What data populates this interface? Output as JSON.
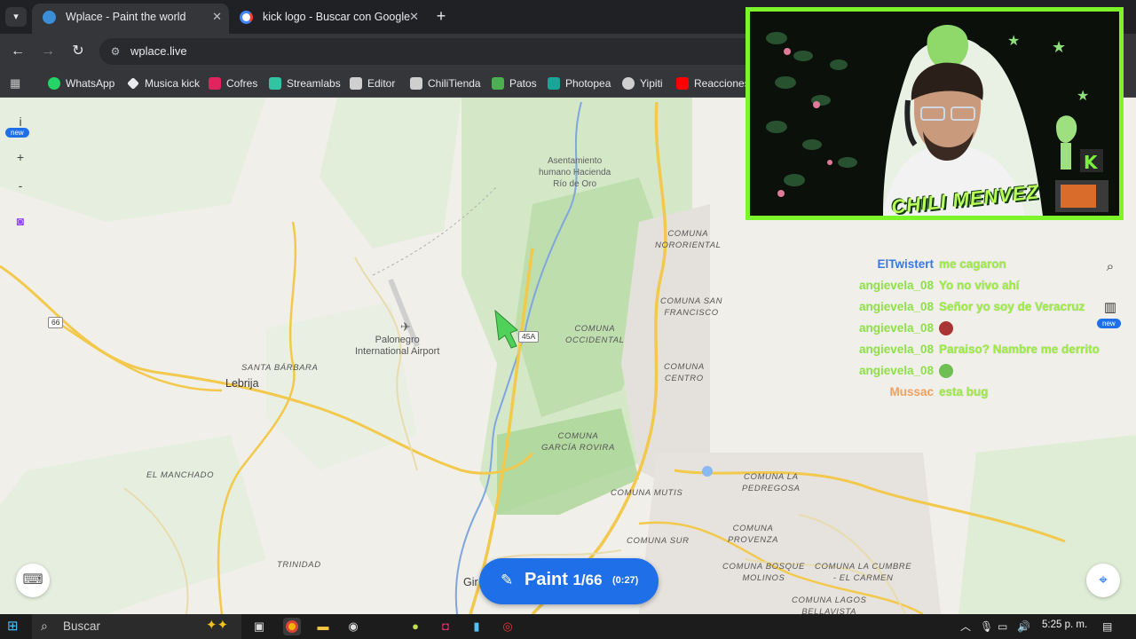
{
  "tabs": [
    {
      "title": "Wplace - Paint the world",
      "active": true,
      "favicon_color": "#3b8fd9"
    },
    {
      "title": "kick logo - Buscar con Google",
      "active": false,
      "favicon_color": "#e8eaed"
    }
  ],
  "toolbar": {
    "url": "wplace.live",
    "back_icon": "arrow-left-icon",
    "forward_icon": "arrow-right-icon",
    "reload_icon": "reload-icon"
  },
  "bookmarks": [
    {
      "label": "WhatsApp",
      "color": "#25d366"
    },
    {
      "label": "Musica kick",
      "color": "#e8eaed"
    },
    {
      "label": "Cofres",
      "color": "#e0245e"
    },
    {
      "label": "Streamlabs",
      "color": "#31c3a2"
    },
    {
      "label": "Editor",
      "color": "#cfcfcf"
    },
    {
      "label": "ChiliTienda",
      "color": "#cfcfcf"
    },
    {
      "label": "Patos",
      "color": "#4caf50"
    },
    {
      "label": "Photopea",
      "color": "#18a497"
    },
    {
      "label": "Yipiti",
      "color": "#cfcfcf"
    },
    {
      "label": "Reacciones",
      "color": "#ff0000"
    }
  ],
  "map": {
    "controls": {
      "info": "i",
      "info_badge": "new",
      "zoom_in": "+",
      "zoom_out": "-"
    },
    "labels": {
      "asentamiento": "Asentamiento\nhumano Hacienda\nRío de Oro",
      "comuna_nororiental": "COMUNA\nNORORIENTAL",
      "comuna_san_francisco": "COMUNA SAN\nFRANCISCO",
      "comuna_occidental": "COMUNA\nOCCIDENTAL",
      "comuna_centro": "COMUNA\nCENTRO",
      "comuna_garcia_rovira": "COMUNA\nGARCÍA ROVIRA",
      "comuna_mutis": "COMUNA MUTIS",
      "comuna_la_pedregosa": "COMUNA LA\nPEDREGOSA",
      "comuna_sur": "COMUNA SUR",
      "comuna_provenza": "COMUNA\nPROVENZA",
      "comuna_bosque_molinos": "COMUNA BOSQUE\nMOLINOS",
      "comuna_la_cumbre": "COMUNA LA CUMBRE\n- EL CARMEN",
      "comuna_lagos": "COMUNA LAGOS\nBELLAVISTA",
      "palonegro": "Palonegro\nInternational Airport",
      "santa_barbara": "SANTA BÁRBARA",
      "lebrija": "Lebrija",
      "el_manchado": "EL MANCHADO",
      "trinidad": "TRINIDAD",
      "giron": "Gir"
    },
    "shields": {
      "route_66": "66",
      "route_45a": "45A"
    },
    "paint_button": {
      "label": "Paint",
      "count": "1/66",
      "timer": "(0:27)"
    },
    "right_badge": "new"
  },
  "stream": {
    "name_overlay": "CHILI MENVEZ",
    "chat": [
      {
        "user": "ElTwistert",
        "user_color": "#3a78e0",
        "msg": "me cagaron"
      },
      {
        "user": "angievela_08",
        "user_color": "#8ee04a",
        "msg": "Yo no vivo ahí"
      },
      {
        "user": "angievela_08",
        "user_color": "#8ee04a",
        "msg": "Señor yo soy de Veracruz"
      },
      {
        "user": "angievela_08",
        "user_color": "#8ee04a",
        "msg": "emoji-1"
      },
      {
        "user": "angievela_08",
        "user_color": "#8ee04a",
        "msg": "Paraiso? Nambre me derrito"
      },
      {
        "user": "angievela_08",
        "user_color": "#8ee04a",
        "msg": "emoji-2"
      },
      {
        "user": "Mussac",
        "user_color": "#f0a060",
        "msg": "esta bug"
      }
    ]
  },
  "taskbar": {
    "search_placeholder": "Buscar",
    "clock": "5:25 p. m."
  },
  "colors": {
    "accent_blue": "#1f6fe8",
    "cam_border": "#7cf52a",
    "map_bg": "#f1efe9"
  }
}
